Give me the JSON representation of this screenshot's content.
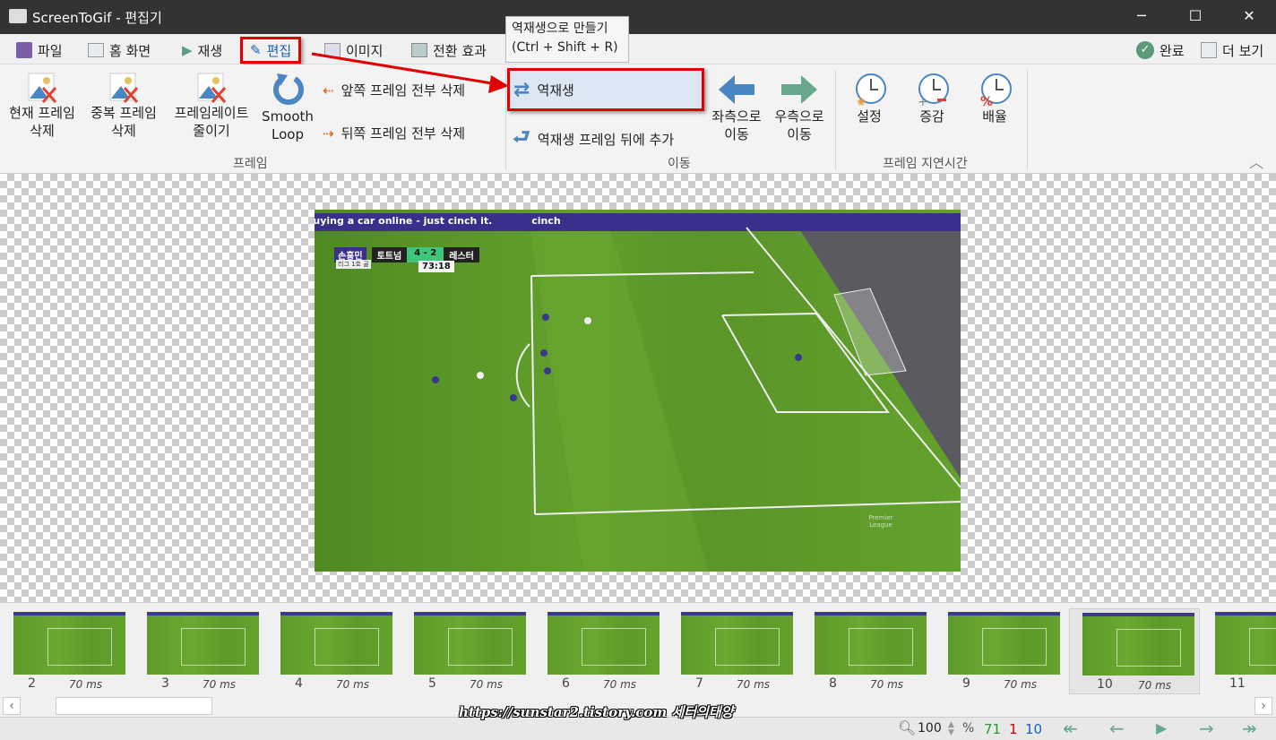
{
  "window": {
    "title": "ScreenToGif - 편집기",
    "minimize": "─",
    "maximize": "☐",
    "close": "✕"
  },
  "tabs": [
    {
      "label": "파일"
    },
    {
      "label": "홈 화면"
    },
    {
      "label": "재생"
    },
    {
      "label": "편집",
      "active": true
    },
    {
      "label": "이미지"
    },
    {
      "label": "전환 효과"
    }
  ],
  "right_tabs": {
    "done": "완료",
    "more": "더 보기"
  },
  "tooltip": {
    "line1": "역재생으로 만들기",
    "line2": "(Ctrl + Shift + R)"
  },
  "ribbon": {
    "frame_group": {
      "label": "프레임",
      "delete_current": [
        "현재 프레임",
        "삭제"
      ],
      "delete_duplicates": [
        "중복 프레임",
        "삭제"
      ],
      "reduce_framerate": [
        "프레임레이트",
        "줄이기"
      ],
      "smooth_loop": [
        "Smooth",
        "Loop"
      ],
      "delete_previous": "앞쪽 프레임 전부 삭제",
      "delete_next": "뒤쪽 프레임 전부 삭제"
    },
    "move_group": {
      "label": "이동",
      "reverse": "역재생",
      "yoyo": "역재생 프레임 뒤에 추가",
      "move_left": [
        "좌측으로",
        "이동"
      ],
      "move_right": [
        "우측으로",
        "이동"
      ]
    },
    "delay_group": {
      "label": "프레임 지연시간",
      "set": "설정",
      "increase_decrease": "증감",
      "scale": "배율"
    }
  },
  "video": {
    "ad_text": "Buying a car online - just cinch it.",
    "ad_brand": "cinch",
    "player": "손흥민",
    "player_sub": "리그 1호 골",
    "home": "토트넘",
    "score": "4 - 2",
    "away": "레스터",
    "clock": "73:18",
    "league_logo": "Premier League"
  },
  "frames": [
    {
      "n": "2",
      "ms": "70 ms"
    },
    {
      "n": "3",
      "ms": "70 ms"
    },
    {
      "n": "4",
      "ms": "70 ms"
    },
    {
      "n": "5",
      "ms": "70 ms"
    },
    {
      "n": "6",
      "ms": "70 ms"
    },
    {
      "n": "7",
      "ms": "70 ms"
    },
    {
      "n": "8",
      "ms": "70 ms"
    },
    {
      "n": "9",
      "ms": "70 ms"
    },
    {
      "n": "10",
      "ms": "70 ms",
      "selected": true
    },
    {
      "n": "11",
      "ms": ""
    }
  ],
  "watermark": "https://sunstar2.tistory.com 세터의태양",
  "status": {
    "zoom": "100",
    "zoom_unit": "%",
    "total_frames": "71",
    "selected_count": "1",
    "current_frame": "10",
    "colors": {
      "total": "#2e9a2e",
      "selected": "#d00000",
      "current": "#1a5fc4"
    }
  },
  "colors": {
    "accent_blue": "#1a5fb4",
    "highlight_red": "#e00000",
    "arrow_blue": "#4a86c2",
    "arrow_green": "#6aa88e",
    "arrow_orange": "#e06a30"
  }
}
